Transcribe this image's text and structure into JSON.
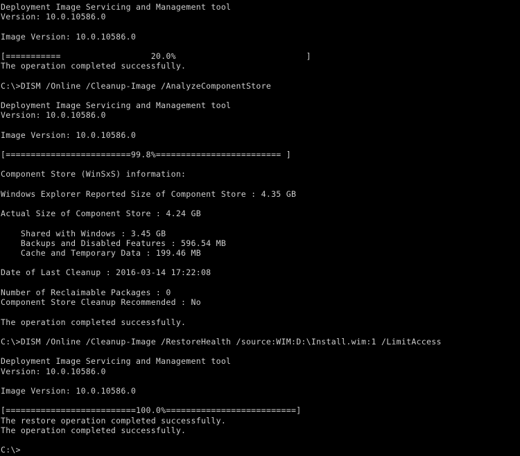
{
  "terminal": {
    "title": "DISM Deployment Image Servicing and Management tool console output",
    "background_color": "#000000",
    "text_color": "#cfcfcf",
    "prompt": "C:\\>",
    "cursor_visible": false,
    "lines": [
      "Deployment Image Servicing and Management tool",
      "Version: 10.0.10586.0",
      "",
      "Image Version: 10.0.10586.0",
      "",
      "[===========                  20.0%                          ]",
      "The operation completed successfully.",
      "",
      "C:\\>DISM /Online /Cleanup-Image /AnalyzeComponentStore",
      "",
      "Deployment Image Servicing and Management tool",
      "Version: 10.0.10586.0",
      "",
      "Image Version: 10.0.10586.0",
      "",
      "[=========================99.8%========================= ]",
      "",
      "Component Store (WinSxS) information:",
      "",
      "Windows Explorer Reported Size of Component Store : 4.35 GB",
      "",
      "Actual Size of Component Store : 4.24 GB",
      "",
      "    Shared with Windows : 3.45 GB",
      "    Backups and Disabled Features : 596.54 MB",
      "    Cache and Temporary Data : 199.46 MB",
      "",
      "Date of Last Cleanup : 2016-03-14 17:22:08",
      "",
      "Number of Reclaimable Packages : 0",
      "Component Store Cleanup Recommended : No",
      "",
      "The operation completed successfully.",
      "",
      "C:\\>DISM /Online /Cleanup-Image /RestoreHealth /source:WIM:D:\\Install.wim:1 /LimitAccess",
      "",
      "Deployment Image Servicing and Management tool",
      "Version: 10.0.10586.0",
      "",
      "Image Version: 10.0.10586.0",
      "",
      "[==========================100.0%==========================]",
      "The restore operation completed successfully.",
      "The operation completed successfully.",
      "",
      "C:\\>"
    ],
    "commands": [
      "DISM /Online /Cleanup-Image /AnalyzeComponentStore",
      "DISM /Online /Cleanup-Image /RestoreHealth /source:WIM:D:\\Install.wim:1 /LimitAccess"
    ],
    "tool_name": "Deployment Image Servicing and Management tool",
    "version": "10.0.10586.0",
    "image_version": "10.0.10586.0",
    "progress_bars": [
      {
        "percent": "20.0%",
        "filled": 11,
        "total": 58
      },
      {
        "percent": "99.8%",
        "filled": 25,
        "total": 55
      },
      {
        "percent": "100.0%",
        "filled": 26,
        "total": 58
      }
    ],
    "component_store": {
      "heading": "Component Store (WinSxS) information:",
      "explorer_reported_size_label": "Windows Explorer Reported Size of Component Store",
      "explorer_reported_size_value": "4.35 GB",
      "actual_size_label": "Actual Size of Component Store",
      "actual_size_value": "4.24 GB",
      "shared_with_windows_label": "Shared with Windows",
      "shared_with_windows_value": "3.45 GB",
      "backups_label": "Backups and Disabled Features",
      "backups_value": "596.54 MB",
      "cache_label": "Cache and Temporary Data",
      "cache_value": "199.46 MB",
      "last_cleanup_label": "Date of Last Cleanup",
      "last_cleanup_value": "2016-03-14 17:22:08",
      "reclaimable_packages_label": "Number of Reclaimable Packages",
      "reclaimable_packages_value": "0",
      "cleanup_recommended_label": "Component Store Cleanup Recommended",
      "cleanup_recommended_value": "No"
    },
    "status_messages": [
      "The operation completed successfully.",
      "The restore operation completed successfully.",
      "The operation completed successfully."
    ]
  }
}
